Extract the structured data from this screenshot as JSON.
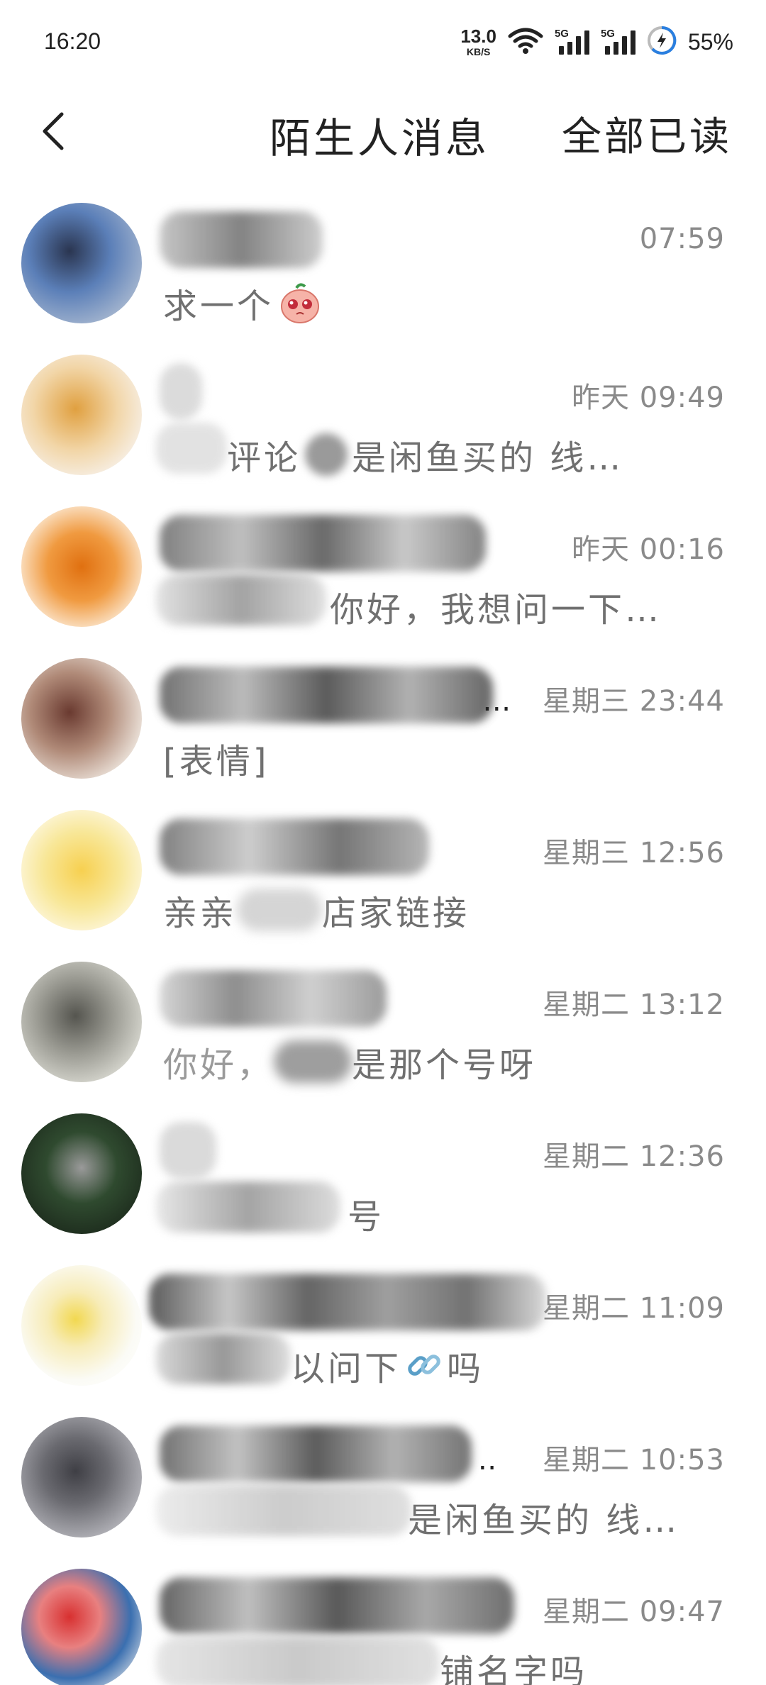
{
  "status_bar": {
    "time": "16:20",
    "net_speed_value": "13.0",
    "net_speed_unit": "KB/S",
    "sim1_label": "5G",
    "sim2_label": "5G",
    "battery": "55%"
  },
  "header": {
    "title": "陌生人消息",
    "mark_all_read": "全部已读"
  },
  "messages": [
    {
      "time": "07:59",
      "preview": "求一个",
      "avatar_color": "#5b7fb8"
    },
    {
      "time": "昨天 09:49",
      "preview_prefix": "",
      "preview": "是闲鱼买的 线…",
      "preview_partial": "评论",
      "avatar_color": "#e0a040"
    },
    {
      "time": "昨天 00:16",
      "preview": "你好，我想问一下…",
      "avatar_color": "#e88020"
    },
    {
      "time": "星期三 23:44",
      "preview": "[表情]",
      "name_suffix": "…",
      "avatar_color": "#8a5a4a"
    },
    {
      "time": "星期三 12:56",
      "preview_a": "亲亲",
      "preview_b": "店家链接",
      "avatar_color": "#f5d860"
    },
    {
      "time": "星期二 13:12",
      "preview_a": "你好，",
      "preview_b": "是那个号呀",
      "avatar_color": "#9a9a92"
    },
    {
      "time": "星期二 12:36",
      "preview": "号",
      "avatar_color": "#2f4a2f"
    },
    {
      "time": "星期二 11:09",
      "preview_a": "以问下",
      "preview_b": "吗",
      "avatar_color": "#f2d850"
    },
    {
      "time": "星期二 10:53",
      "preview": "是闲鱼买的 线…",
      "avatar_color": "#6a6a70"
    },
    {
      "time": "星期二 09:47",
      "preview": "铺名字吗",
      "avatar_color": "#d83030"
    }
  ]
}
